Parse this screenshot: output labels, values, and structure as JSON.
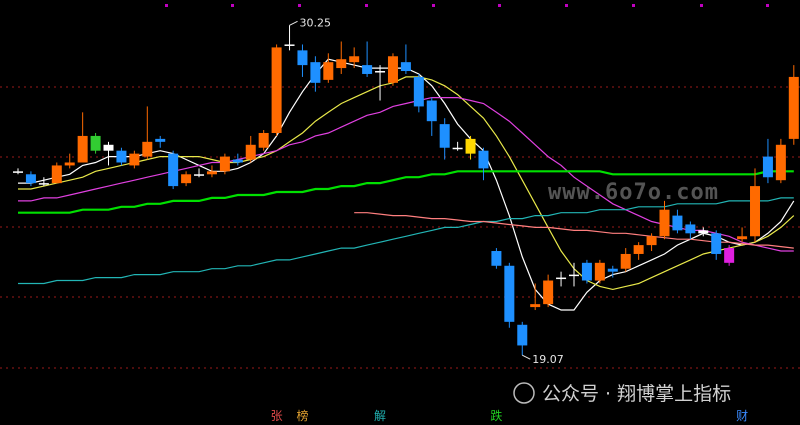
{
  "chart_data": {
    "type": "candlestick",
    "ylim": [
      18.5,
      30.7
    ],
    "high_label": "30.25",
    "low_label": "19.07",
    "candles": [
      {
        "o": 25.3,
        "c": 25.3,
        "h": 25.4,
        "l": 25.2,
        "col": "flat"
      },
      {
        "o": 25.2,
        "c": 24.9,
        "h": 25.3,
        "l": 24.8,
        "col": "down"
      },
      {
        "o": 24.9,
        "c": 24.9,
        "h": 25.1,
        "l": 24.8,
        "col": "flat"
      },
      {
        "o": 24.9,
        "c": 25.5,
        "h": 25.6,
        "l": 24.9,
        "col": "up"
      },
      {
        "o": 25.5,
        "c": 25.6,
        "h": 25.9,
        "l": 25.4,
        "col": "up"
      },
      {
        "o": 25.6,
        "c": 26.5,
        "h": 27.3,
        "l": 25.6,
        "col": "up"
      },
      {
        "o": 26.5,
        "c": 26.0,
        "h": 26.6,
        "l": 25.9,
        "col": "lime"
      },
      {
        "o": 26.0,
        "c": 26.2,
        "h": 26.3,
        "l": 25.5,
        "col": "flat"
      },
      {
        "o": 26.0,
        "c": 25.6,
        "h": 26.1,
        "l": 25.5,
        "col": "down"
      },
      {
        "o": 25.5,
        "c": 25.9,
        "h": 26.0,
        "l": 25.4,
        "col": "up"
      },
      {
        "o": 25.8,
        "c": 26.3,
        "h": 27.5,
        "l": 25.7,
        "col": "up"
      },
      {
        "o": 26.4,
        "c": 26.3,
        "h": 26.5,
        "l": 26.1,
        "col": "down"
      },
      {
        "o": 25.9,
        "c": 24.8,
        "h": 26.0,
        "l": 24.7,
        "col": "down"
      },
      {
        "o": 24.9,
        "c": 25.2,
        "h": 25.3,
        "l": 24.8,
        "col": "up"
      },
      {
        "o": 25.2,
        "c": 25.2,
        "h": 25.4,
        "l": 25.1,
        "col": "flat"
      },
      {
        "o": 25.2,
        "c": 25.3,
        "h": 25.5,
        "l": 25.1,
        "col": "up"
      },
      {
        "o": 25.3,
        "c": 25.8,
        "h": 25.9,
        "l": 25.2,
        "col": "up"
      },
      {
        "o": 25.7,
        "c": 25.6,
        "h": 25.9,
        "l": 25.5,
        "col": "down"
      },
      {
        "o": 25.7,
        "c": 26.2,
        "h": 26.5,
        "l": 25.6,
        "col": "up"
      },
      {
        "o": 26.1,
        "c": 26.6,
        "h": 26.7,
        "l": 26.0,
        "col": "up"
      },
      {
        "o": 26.6,
        "c": 29.5,
        "h": 29.6,
        "l": 26.5,
        "col": "up"
      },
      {
        "o": 29.6,
        "c": 29.6,
        "h": 30.25,
        "l": 29.4,
        "col": "flat"
      },
      {
        "o": 29.4,
        "c": 28.9,
        "h": 29.6,
        "l": 28.5,
        "col": "down"
      },
      {
        "o": 29.0,
        "c": 28.3,
        "h": 29.2,
        "l": 28.0,
        "col": "down"
      },
      {
        "o": 28.4,
        "c": 29.0,
        "h": 29.3,
        "l": 28.3,
        "col": "up"
      },
      {
        "o": 28.8,
        "c": 29.1,
        "h": 29.7,
        "l": 28.6,
        "col": "up"
      },
      {
        "o": 29.0,
        "c": 29.2,
        "h": 29.5,
        "l": 28.8,
        "col": "up"
      },
      {
        "o": 28.9,
        "c": 28.6,
        "h": 29.7,
        "l": 28.5,
        "col": "down"
      },
      {
        "o": 28.7,
        "c": 28.7,
        "h": 28.9,
        "l": 27.7,
        "col": "flat"
      },
      {
        "o": 28.3,
        "c": 29.2,
        "h": 29.3,
        "l": 28.2,
        "col": "up"
      },
      {
        "o": 29.0,
        "c": 28.7,
        "h": 29.6,
        "l": 28.6,
        "col": "down"
      },
      {
        "o": 28.5,
        "c": 27.5,
        "h": 28.6,
        "l": 27.3,
        "col": "down"
      },
      {
        "o": 27.7,
        "c": 27.0,
        "h": 27.8,
        "l": 26.5,
        "col": "down"
      },
      {
        "o": 26.9,
        "c": 26.1,
        "h": 27.1,
        "l": 25.7,
        "col": "down"
      },
      {
        "o": 26.1,
        "c": 26.1,
        "h": 26.3,
        "l": 26.0,
        "col": "flat"
      },
      {
        "o": 26.4,
        "c": 25.9,
        "h": 26.5,
        "l": 25.7,
        "col": "yellow"
      },
      {
        "o": 26.0,
        "c": 25.4,
        "h": 26.1,
        "l": 25.0,
        "col": "down"
      },
      {
        "o": 22.6,
        "c": 22.1,
        "h": 22.7,
        "l": 22.0,
        "col": "down"
      },
      {
        "o": 22.1,
        "c": 20.2,
        "h": 22.2,
        "l": 20.0,
        "col": "down"
      },
      {
        "o": 20.1,
        "c": 19.4,
        "h": 20.2,
        "l": 19.07,
        "col": "down"
      },
      {
        "o": 20.7,
        "c": 20.8,
        "h": 21.5,
        "l": 20.6,
        "col": "up"
      },
      {
        "o": 20.8,
        "c": 21.6,
        "h": 21.8,
        "l": 20.7,
        "col": "up"
      },
      {
        "o": 21.7,
        "c": 21.7,
        "h": 21.9,
        "l": 21.4,
        "col": "flat"
      },
      {
        "o": 21.8,
        "c": 21.8,
        "h": 22.2,
        "l": 21.4,
        "col": "flat"
      },
      {
        "o": 22.2,
        "c": 21.6,
        "h": 22.3,
        "l": 21.5,
        "col": "down"
      },
      {
        "o": 21.6,
        "c": 22.2,
        "h": 22.3,
        "l": 21.5,
        "col": "up"
      },
      {
        "o": 22.0,
        "c": 21.9,
        "h": 22.1,
        "l": 21.7,
        "col": "down"
      },
      {
        "o": 22.0,
        "c": 22.5,
        "h": 22.7,
        "l": 21.9,
        "col": "up"
      },
      {
        "o": 22.5,
        "c": 22.8,
        "h": 22.9,
        "l": 22.3,
        "col": "up"
      },
      {
        "o": 22.8,
        "c": 23.1,
        "h": 23.2,
        "l": 22.6,
        "col": "up"
      },
      {
        "o": 23.1,
        "c": 24.0,
        "h": 24.3,
        "l": 23.0,
        "col": "up"
      },
      {
        "o": 23.8,
        "c": 23.3,
        "h": 24.0,
        "l": 23.2,
        "col": "down"
      },
      {
        "o": 23.5,
        "c": 23.2,
        "h": 23.6,
        "l": 23.0,
        "col": "down"
      },
      {
        "o": 23.3,
        "c": 23.2,
        "h": 23.4,
        "l": 23.1,
        "col": "flat"
      },
      {
        "o": 23.2,
        "c": 22.5,
        "h": 23.3,
        "l": 22.3,
        "col": "down"
      },
      {
        "o": 22.7,
        "c": 22.2,
        "h": 22.8,
        "l": 22.1,
        "col": "magenta"
      },
      {
        "o": 23.0,
        "c": 23.1,
        "h": 23.4,
        "l": 22.9,
        "col": "up"
      },
      {
        "o": 23.1,
        "c": 24.8,
        "h": 25.4,
        "l": 22.9,
        "col": "up"
      },
      {
        "o": 25.1,
        "c": 25.8,
        "h": 26.4,
        "l": 24.9,
        "col": "down"
      },
      {
        "o": 25.0,
        "c": 26.2,
        "h": 26.4,
        "l": 24.9,
        "col": "up"
      },
      {
        "o": 26.4,
        "c": 28.5,
        "h": 28.9,
        "l": 26.2,
        "col": "up"
      }
    ],
    "ma_lines": [
      {
        "color": "#ffffff",
        "values": [
          24.9,
          24.9,
          25.0,
          25.1,
          25.2,
          25.5,
          25.6,
          25.8,
          25.8,
          25.8,
          25.9,
          26.0,
          25.9,
          25.7,
          25.5,
          25.3,
          25.3,
          25.4,
          25.6,
          25.9,
          26.5,
          27.3,
          28.0,
          28.6,
          29.1,
          29.0,
          28.9,
          28.8,
          28.8,
          28.8,
          28.8,
          28.6,
          28.2,
          27.6,
          26.9,
          26.4,
          26.0,
          25.0,
          23.8,
          22.4,
          21.3,
          20.8,
          20.6,
          20.6,
          21.2,
          21.6,
          21.8,
          21.9,
          22.1,
          22.3,
          22.5,
          22.8,
          23.0,
          23.2,
          23.1,
          22.9,
          22.8,
          22.9,
          23.2,
          23.6,
          24.3
        ]
      },
      {
        "color": "#e8e84a",
        "values": [
          24.7,
          24.7,
          24.8,
          24.9,
          25.0,
          25.1,
          25.3,
          25.4,
          25.5,
          25.6,
          25.7,
          25.8,
          25.8,
          25.8,
          25.8,
          25.7,
          25.6,
          25.6,
          25.7,
          25.8,
          26.0,
          26.3,
          26.6,
          27.0,
          27.3,
          27.6,
          27.8,
          28.0,
          28.2,
          28.3,
          28.5,
          28.5,
          28.4,
          28.2,
          27.9,
          27.5,
          27.1,
          26.5,
          25.8,
          25.0,
          24.2,
          23.4,
          22.6,
          22.0,
          21.6,
          21.4,
          21.3,
          21.4,
          21.5,
          21.7,
          21.9,
          22.1,
          22.3,
          22.5,
          22.6,
          22.7,
          22.8,
          22.9,
          23.1,
          23.4,
          23.8
        ]
      },
      {
        "color": "#e040e0",
        "values": [
          24.3,
          24.3,
          24.4,
          24.4,
          24.5,
          24.6,
          24.7,
          24.8,
          24.9,
          25.0,
          25.1,
          25.2,
          25.3,
          25.4,
          25.5,
          25.6,
          25.6,
          25.7,
          25.8,
          25.9,
          26.0,
          26.2,
          26.3,
          26.5,
          26.6,
          26.8,
          27.0,
          27.2,
          27.3,
          27.5,
          27.6,
          27.7,
          27.8,
          27.8,
          27.8,
          27.7,
          27.6,
          27.3,
          27.0,
          26.6,
          26.2,
          25.8,
          25.5,
          25.1,
          24.8,
          24.5,
          24.2,
          24.0,
          23.8,
          23.6,
          23.5,
          23.4,
          23.3,
          23.3,
          23.2,
          23.1,
          22.9,
          22.8,
          22.7,
          22.6,
          22.6
        ]
      },
      {
        "color": "#00e000",
        "values": [
          23.9,
          23.9,
          23.9,
          23.9,
          23.9,
          24.0,
          24.0,
          24.0,
          24.1,
          24.1,
          24.2,
          24.2,
          24.3,
          24.3,
          24.3,
          24.4,
          24.4,
          24.5,
          24.5,
          24.5,
          24.6,
          24.6,
          24.6,
          24.7,
          24.7,
          24.8,
          24.8,
          24.9,
          24.9,
          25.0,
          25.1,
          25.1,
          25.2,
          25.2,
          25.3,
          25.3,
          25.3,
          25.3,
          25.3,
          25.3,
          25.3,
          25.3,
          25.3,
          25.3,
          25.3,
          25.3,
          25.2,
          25.2,
          25.2,
          25.2,
          25.2,
          25.2,
          25.2,
          25.2,
          25.2,
          25.2,
          25.2,
          25.2,
          25.3,
          25.3,
          25.3
        ]
      },
      {
        "color": "#22b5b5",
        "values": [
          21.5,
          21.5,
          21.5,
          21.6,
          21.6,
          21.6,
          21.7,
          21.7,
          21.7,
          21.8,
          21.8,
          21.8,
          21.9,
          21.9,
          21.9,
          22.0,
          22.0,
          22.1,
          22.1,
          22.2,
          22.3,
          22.3,
          22.4,
          22.5,
          22.6,
          22.7,
          22.7,
          22.8,
          22.9,
          23.0,
          23.1,
          23.2,
          23.3,
          23.4,
          23.4,
          23.5,
          23.6,
          23.6,
          23.7,
          23.7,
          23.8,
          23.8,
          23.9,
          23.9,
          23.9,
          24.0,
          24.0,
          24.0,
          24.1,
          24.1,
          24.1,
          24.2,
          24.2,
          24.2,
          24.2,
          24.3,
          24.3,
          24.3,
          24.3,
          24.4,
          24.4
        ]
      },
      {
        "color": "#ff7f7f",
        "start": 26,
        "values": [
          23.9,
          23.9,
          23.85,
          23.8,
          23.8,
          23.75,
          23.7,
          23.7,
          23.65,
          23.6,
          23.6,
          23.55,
          23.5,
          23.45,
          23.4,
          23.4,
          23.35,
          23.3,
          23.3,
          23.25,
          23.2,
          23.2,
          23.15,
          23.1,
          23.05,
          23.0,
          23.0,
          22.95,
          22.9,
          22.9,
          22.85,
          22.8,
          22.8,
          22.75,
          22.7
        ]
      }
    ],
    "event_labels": [
      {
        "i": 20,
        "text": "张",
        "color": "#e04a4a"
      },
      {
        "i": 22,
        "text": "榜",
        "color": "#e0a030"
      },
      {
        "i": 28,
        "text": "解",
        "color": "#20b0b0"
      },
      {
        "i": 37,
        "text": "跌",
        "color": "#20d020"
      },
      {
        "i": 56,
        "text": "财",
        "color": "#3a8aff"
      }
    ],
    "watermark": "www.6o7o.com",
    "caption": "公众号 · 翔博掌上指标",
    "colors": {
      "up": "#ff6a00",
      "down": "#1e90ff",
      "flat": "#ffffff",
      "lime": "#32cd32",
      "yellow": "#ffd700",
      "magenta": "#e020e0",
      "grid": "#9a1a1a",
      "tick": "#c000c0"
    }
  }
}
